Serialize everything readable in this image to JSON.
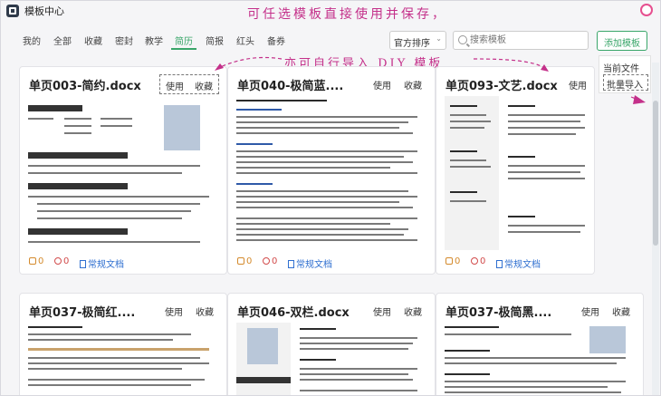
{
  "app": {
    "title": "模板中心"
  },
  "annotations": {
    "top": "可任选模板直接使用并保存，",
    "middle": "亦可自行导入 DIY 模板"
  },
  "tabs": [
    {
      "label": "我的"
    },
    {
      "label": "全部"
    },
    {
      "label": "收藏"
    },
    {
      "label": "密封"
    },
    {
      "label": "教学"
    },
    {
      "label": "简历"
    },
    {
      "label": "简报"
    },
    {
      "label": "红头"
    },
    {
      "label": "备券"
    }
  ],
  "active_tab": "简历",
  "sort": {
    "value": "官方排序"
  },
  "search": {
    "placeholder": "搜索模板"
  },
  "add_button": {
    "label": "添加模板"
  },
  "dropdown": {
    "items": [
      {
        "label": "当前文件"
      },
      {
        "label": "批量导入"
      }
    ]
  },
  "cards": [
    {
      "title": "单页003-简约.docx",
      "use": "使用",
      "fav": "收藏",
      "like": "0",
      "dislike": "0",
      "doc": "常规文档"
    },
    {
      "title": "单页040-极简蓝....",
      "use": "使用",
      "fav": "收藏",
      "like": "0",
      "dislike": "0",
      "doc": "常规文档"
    },
    {
      "title": "单页093-文艺.docx",
      "use": "使用",
      "fav": "",
      "like": "0",
      "dislike": "0",
      "doc": "常规文档"
    },
    {
      "title": "单页037-极简红....",
      "use": "使用",
      "fav": "收藏"
    },
    {
      "title": "单页046-双栏.docx",
      "use": "使用",
      "fav": "收藏"
    },
    {
      "title": "单页037-极简黑....",
      "use": "使用",
      "fav": "收藏"
    }
  ],
  "colors": {
    "accent": "#3aa66a",
    "annotation": "#c4308a"
  }
}
